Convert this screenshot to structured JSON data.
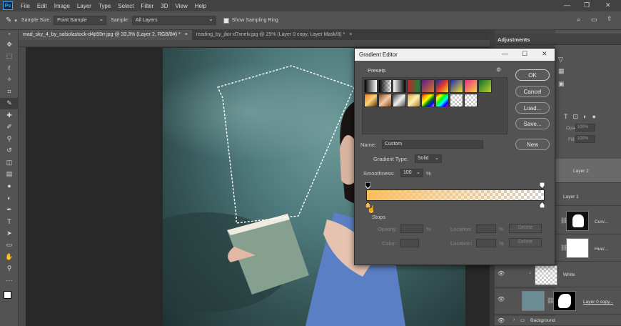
{
  "menubar": {
    "logo": "Ps",
    "items": [
      "File",
      "Edit",
      "Image",
      "Layer",
      "Type",
      "Select",
      "Filter",
      "3D",
      "View",
      "Help"
    ]
  },
  "options_bar": {
    "sample_size_label": "Sample Size:",
    "sample_size_value": "Point Sample",
    "sample_label": "Sample:",
    "sample_value": "All Layers",
    "show_ring_label": "Show Sampling Ring"
  },
  "tabs": [
    {
      "label": "mad_sky_4_by_salsolastock-d4p59rr.jpg @ 33,3% (Layer 2, RGB/8#) *",
      "close": "×",
      "active": true
    },
    {
      "label": "reading_by_jlior-d7xnelv.jpg @ 25% (Layer 0 copy, Layer Mask/8) *",
      "close": "×",
      "active": false
    }
  ],
  "gradient_editor": {
    "title": "Gradient Editor",
    "presets_label": "Presets",
    "ok": "OK",
    "cancel": "Cancel",
    "load": "Load...",
    "save": "Save...",
    "name_label": "Name:",
    "name_value": "Custom",
    "new": "New",
    "gradient_type_label": "Gradient Type:",
    "gradient_type_value": "Solid",
    "smoothness_label": "Smoothness:",
    "smoothness_value": "100",
    "smoothness_unit": "%",
    "stops_label": "Stops",
    "opacity_label": "Opacity:",
    "opacity_unit": "%",
    "location_label": "Location:",
    "location_unit": "%",
    "delete": "Delete",
    "color_label": "Color:",
    "location2_label": "Location:",
    "location2_unit": "%",
    "delete2": "Delete"
  },
  "panels": {
    "adjustments_label": "Adjustments",
    "opacity_label": "Opacity:",
    "opacity_value": "100%",
    "fill_label": "Fill:",
    "fill_value": "100%",
    "layers": [
      {
        "name": "Layer 2"
      },
      {
        "name": "Layer 1"
      },
      {
        "name": "Curv..."
      },
      {
        "name": "Hue/..."
      },
      {
        "name": "White"
      },
      {
        "name": "Layer 0 copy..."
      },
      {
        "name": "Background"
      }
    ]
  }
}
